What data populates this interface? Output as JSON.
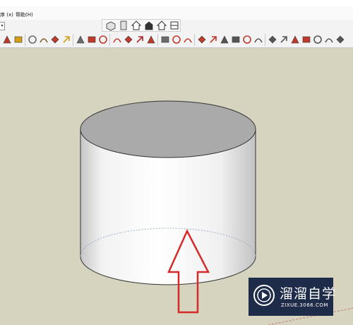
{
  "menu": [
    {
      "label": "序 (x)"
    },
    {
      "label": "帮助(H)"
    }
  ],
  "toolbar": {
    "dropdown_symbol": "▾",
    "views": [
      {
        "name": "iso-view-icon"
      },
      {
        "name": "top-view-icon"
      },
      {
        "name": "front-view-icon"
      },
      {
        "name": "right-view-icon"
      },
      {
        "name": "back-view-icon"
      },
      {
        "name": "left-view-icon"
      }
    ],
    "tools": [
      {
        "name": "select-tool-icon",
        "color": "#c0392b"
      },
      {
        "name": "paint-bucket-icon",
        "color": "#d4a017"
      },
      {
        "name": "dimension-tool-icon",
        "color": "#6b6b6b"
      },
      {
        "name": "walk-tool-icon",
        "color": "#7a5c2e"
      },
      {
        "name": "orbit-tool-icon",
        "color": "#c0392b"
      },
      {
        "name": "pan-tool-icon",
        "color": "#d4a017"
      },
      {
        "name": "zoom-tool-icon",
        "color": "#6b6b6b"
      },
      {
        "name": "zoom-extents-icon",
        "color": "#c0392b"
      },
      {
        "name": "warehouse-icon",
        "color": "#c0392b"
      },
      {
        "name": "extension-warehouse-icon",
        "color": "#c0392b"
      },
      {
        "name": "share-model-icon",
        "color": "#c0392b"
      },
      {
        "name": "ruby-console-icon",
        "color": "#b0282c"
      },
      {
        "name": "line-tool-icon",
        "color": "#c0392b"
      },
      {
        "name": "freehand-tool-icon",
        "color": "#6b6b6b"
      },
      {
        "name": "arc-tool-icon",
        "color": "#c0392b"
      },
      {
        "name": "bezier-curve-icon",
        "color": "#c0392b"
      },
      {
        "name": "curve-edit-icon",
        "color": "#c0392b"
      },
      {
        "name": "protractor-icon",
        "color": "#c0392b"
      },
      {
        "name": "solid-box-icon",
        "color": "#555555"
      },
      {
        "name": "solid-tools-icon",
        "color": "#555555"
      },
      {
        "name": "move-tool-icon",
        "color": "#c0392b"
      },
      {
        "name": "rotate-tool-icon",
        "color": "#555555"
      },
      {
        "name": "scale-tool-icon",
        "color": "#555555"
      },
      {
        "name": "offset-tool-icon",
        "color": "#555555"
      },
      {
        "name": "follow-me-icon",
        "color": "#c0392b"
      },
      {
        "name": "sandbox-icon",
        "color": "#c0392b"
      },
      {
        "name": "intersect-icon",
        "color": "#555555"
      },
      {
        "name": "outer-shell-icon",
        "color": "#555555"
      },
      {
        "name": "split-icon",
        "color": "#555555"
      },
      {
        "name": "trim-icon",
        "color": "#555555"
      }
    ]
  },
  "scene": {
    "shape": "cylinder",
    "cylinder_top_color": "#aaaaaa",
    "cylinder_side_light": "#fcfcfc",
    "cylinder_side_shadow": "#c4c4c4",
    "arrow_color": "#d62a2a"
  },
  "watermark": {
    "title": "溜溜自学",
    "url": "ZIXUE.3066.COM"
  }
}
